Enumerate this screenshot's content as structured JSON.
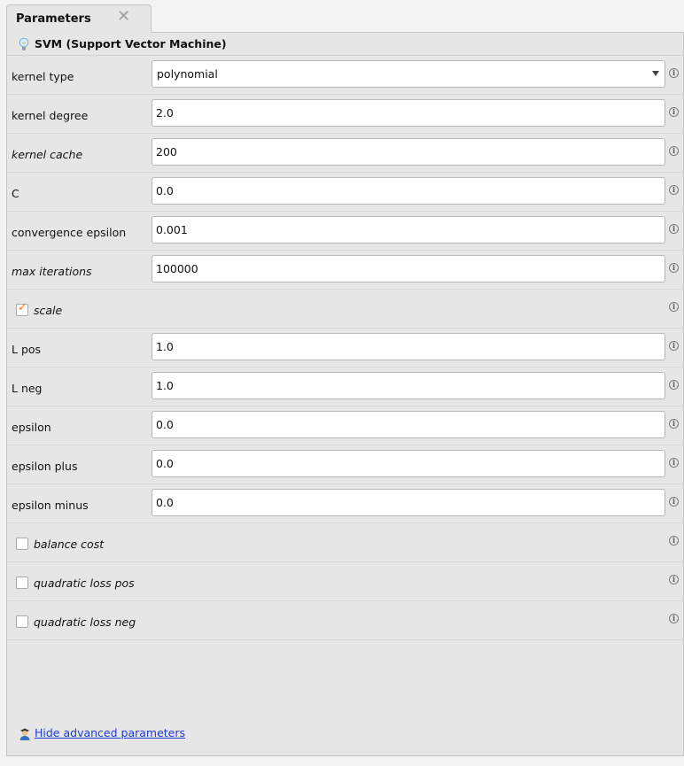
{
  "tab": {
    "title": "Parameters",
    "close_glyph": "✕"
  },
  "operator": {
    "title": "SVM (Support Vector Machine)",
    "icon": "lightbulb-icon"
  },
  "params": {
    "kernel_type": {
      "label": "kernel type",
      "value": "polynomial"
    },
    "kernel_degree": {
      "label": "kernel degree",
      "value": "2.0"
    },
    "kernel_cache": {
      "label": "kernel cache",
      "value": "200"
    },
    "c": {
      "label": "C",
      "value": "0.0"
    },
    "convergence_epsilon": {
      "label": "convergence epsilon",
      "value": "0.001"
    },
    "max_iterations": {
      "label": "max iterations",
      "value": "100000"
    },
    "scale": {
      "label": "scale",
      "checked": true
    },
    "l_pos": {
      "label": "L pos",
      "value": "1.0"
    },
    "l_neg": {
      "label": "L neg",
      "value": "1.0"
    },
    "epsilon": {
      "label": "epsilon",
      "value": "0.0"
    },
    "epsilon_plus": {
      "label": "epsilon plus",
      "value": "0.0"
    },
    "epsilon_minus": {
      "label": "epsilon minus",
      "value": "0.0"
    },
    "balance_cost": {
      "label": "balance cost",
      "checked": false
    },
    "quadratic_loss_pos": {
      "label": "quadratic loss pos",
      "checked": false
    },
    "quadratic_loss_neg": {
      "label": "quadratic loss neg",
      "checked": false
    }
  },
  "info_glyph": "i",
  "check_glyph": "✓",
  "footer": {
    "link": "Hide advanced parameters",
    "icon": "expert-user-icon"
  },
  "colors": {
    "accent_check": "#f07b22",
    "link": "#1f3bd6",
    "panel_bg": "#e6e6e6"
  }
}
